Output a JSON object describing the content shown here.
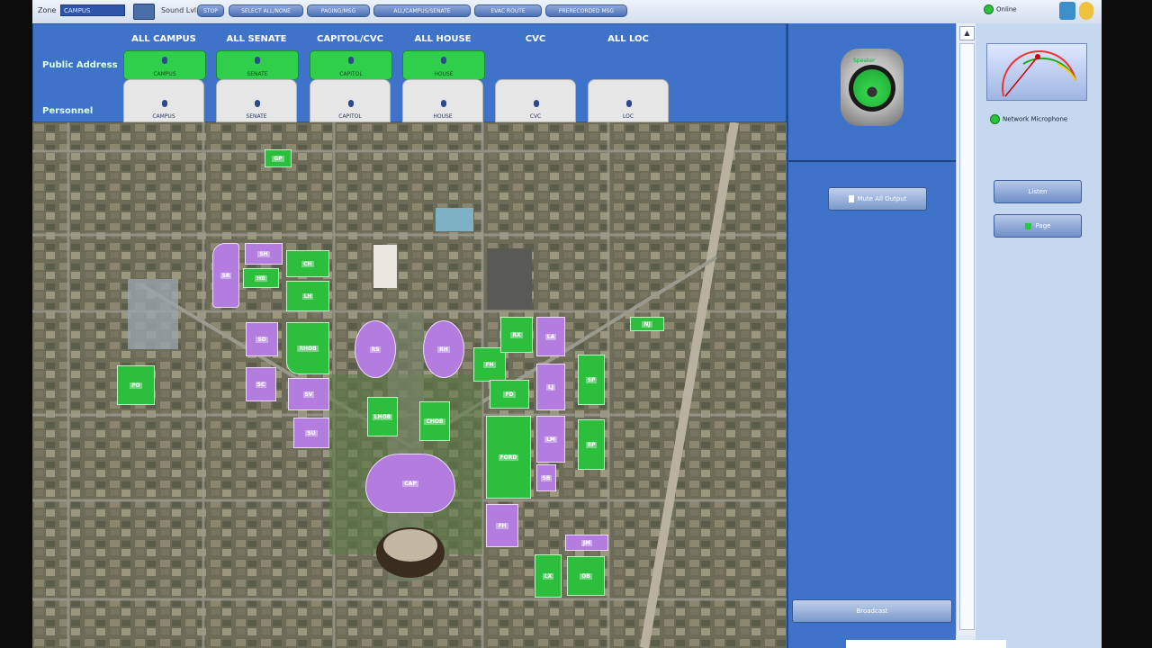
{
  "toolbar": {
    "zone_label": "Zone",
    "zone_value": "CAMPUS",
    "sound_label": "Sound Lvl",
    "buttons": [
      "STOP",
      "SELECT ALL/NONE",
      "PAGING/MSG",
      "ALL/CAMPUS/SENATE",
      "EVAC ROUTE",
      "PRERECORDED MSG"
    ],
    "status": "Online"
  },
  "zones": {
    "row_public_address": "Public Address",
    "row_personnel": "Personnel",
    "items": [
      {
        "title": "ALL CAMPUS",
        "pa": "CAMPUS",
        "ps": "CAMPUS",
        "pa_on": true
      },
      {
        "title": "ALL SENATE",
        "pa": "SENATE",
        "ps": "SENATE",
        "pa_on": true
      },
      {
        "title": "CAPITOL/CVC",
        "pa": "CAPITOL",
        "ps": "CAPITOL",
        "pa_on": true
      },
      {
        "title": "ALL HOUSE",
        "pa": "HOUSE",
        "ps": "HOUSE",
        "pa_on": true
      },
      {
        "title": "CVC",
        "pa": "",
        "ps": "CVC",
        "pa_on": false
      },
      {
        "title": "ALL LOC",
        "pa": "",
        "ps": "LOC",
        "pa_on": false
      }
    ]
  },
  "panel": {
    "speaker_label": "Speaker",
    "mute_button": "Mute All Output",
    "bottom_button": "Broadcast"
  },
  "side": {
    "status": "Network Microphone",
    "button_top": "Listen",
    "button_bottom": "Page"
  },
  "colors": {
    "active_zone": "#2fcf4c",
    "senate_buildings": "#b37de0",
    "house_buildings": "#2bbf3d",
    "header_blue": "#3f73c9"
  }
}
